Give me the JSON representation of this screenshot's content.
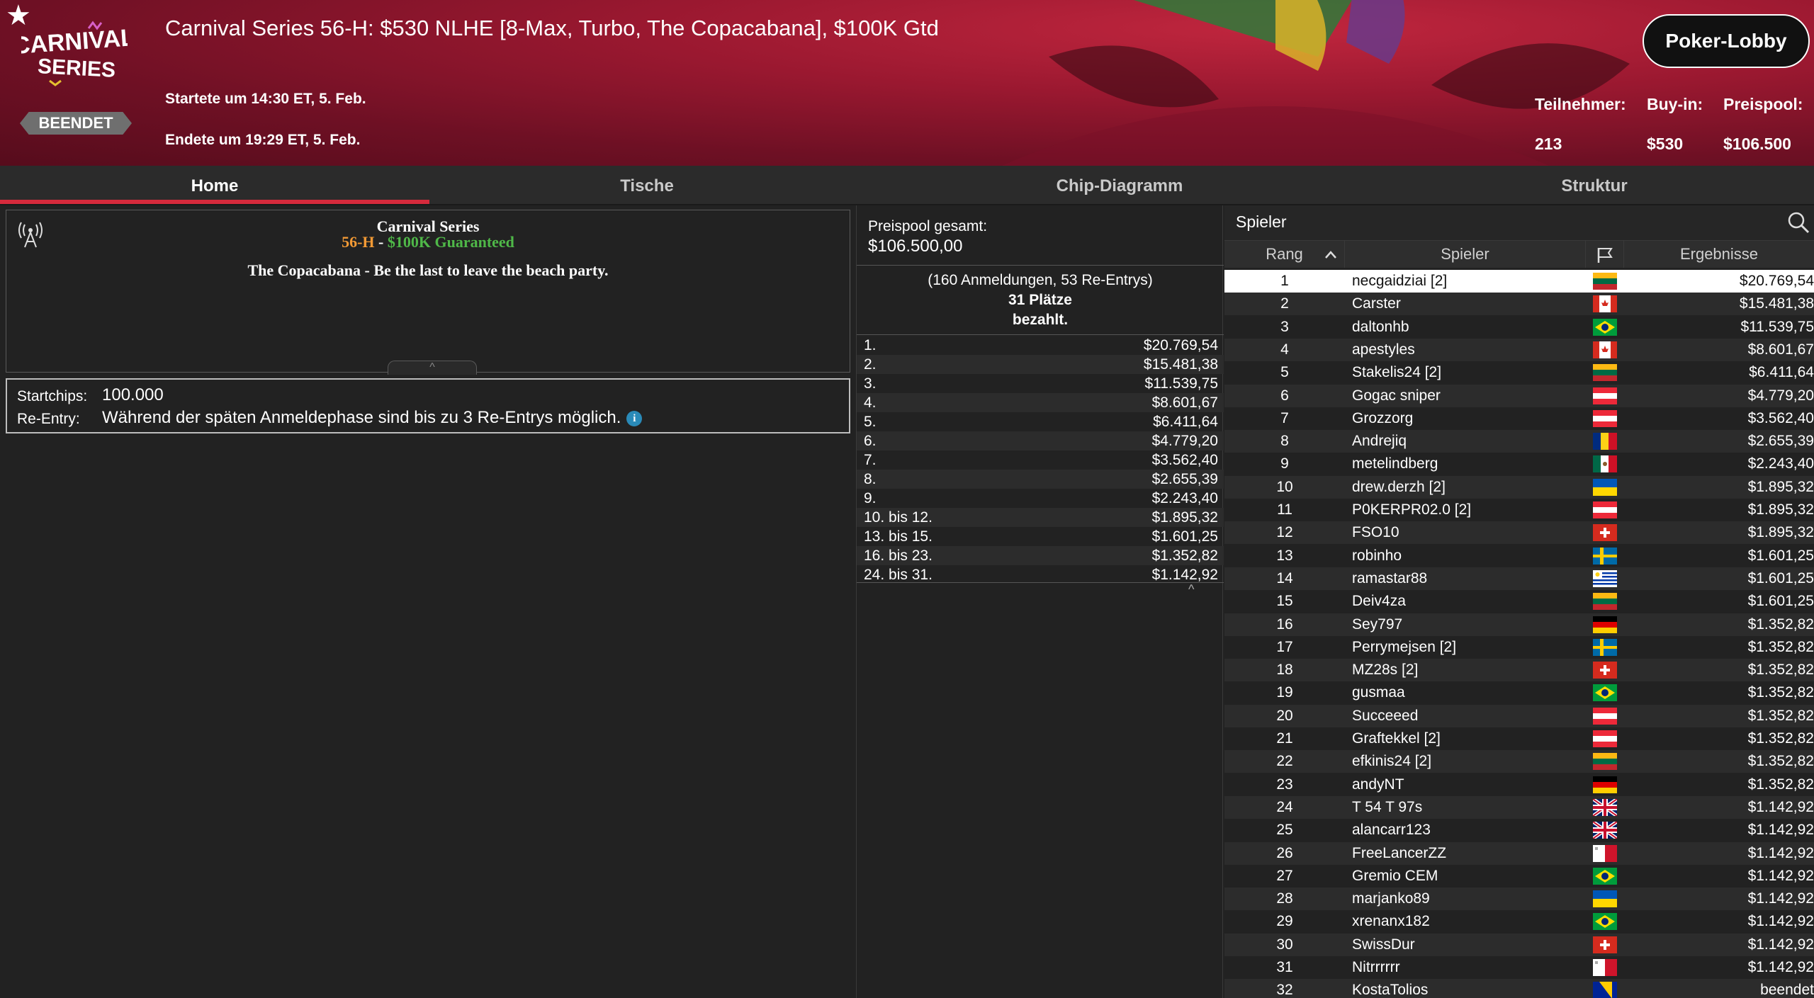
{
  "header": {
    "title": "Carnival Series 56-H: $530 NLHE [8-Max, Turbo, The Copacabana], $100K Gtd",
    "logo_text": "CARNIVAL SERIES",
    "status_badge": "BEENDET",
    "started": "Startete um 14:30 ET, 5. Feb.",
    "ended": "Endete um 19:29 ET, 5. Feb.",
    "lobby_button": "Poker-Lobby",
    "stats": {
      "participants_label": "Teilnehmer:",
      "participants_value": "213",
      "buyin_label": "Buy-in:",
      "buyin_value": "$530",
      "prizepool_label": "Preispool:",
      "prizepool_value": "$106.500"
    }
  },
  "tabs": [
    {
      "label": "Home",
      "active": true
    },
    {
      "label": "Tische",
      "active": false
    },
    {
      "label": "Chip-Diagramm",
      "active": false
    },
    {
      "label": "Struktur",
      "active": false
    }
  ],
  "info": {
    "series_name": "Carnival Series",
    "event_code": "56-H",
    "separator": " - ",
    "guarantee": "$100K Guaranteed",
    "description": "The Copacabana - Be the last to leave the beach party.",
    "collapse_glyph": "^"
  },
  "rules": {
    "startchips_label": "Startchips:",
    "startchips_value": "100.000",
    "reentry_label": "Re-Entry:",
    "reentry_value": "Während der späten Anmeldephase sind bis zu 3 Re-Entrys möglich.",
    "info_glyph": "i"
  },
  "payouts": {
    "pool_label": "Preispool gesamt:",
    "pool_value": "$106.500,00",
    "entries_line1": "(160 Anmeldungen, 53 Re-Entrys)",
    "entries_line2": "31 Plätze",
    "entries_line3": "bezahlt.",
    "rows": [
      {
        "rank": "1.",
        "amount": "$20.769,54"
      },
      {
        "rank": "2.",
        "amount": "$15.481,38"
      },
      {
        "rank": "3.",
        "amount": "$11.539,75"
      },
      {
        "rank": "4.",
        "amount": "$8.601,67"
      },
      {
        "rank": "5.",
        "amount": "$6.411,64"
      },
      {
        "rank": "6.",
        "amount": "$4.779,20"
      },
      {
        "rank": "7.",
        "amount": "$3.562,40"
      },
      {
        "rank": "8.",
        "amount": "$2.655,39"
      },
      {
        "rank": "9.",
        "amount": "$2.243,40"
      },
      {
        "rank": "10. bis 12.",
        "amount": "$1.895,32"
      },
      {
        "rank": "13. bis 15.",
        "amount": "$1.601,25"
      },
      {
        "rank": "16. bis 23.",
        "amount": "$1.352,82"
      },
      {
        "rank": "24. bis 31.",
        "amount": "$1.142,92"
      }
    ],
    "collapse_glyph": "^"
  },
  "players": {
    "search_label": "Spieler",
    "columns": {
      "rank": "Rang",
      "player": "Spieler",
      "results": "Ergebnisse"
    },
    "rows": [
      {
        "rank": "1",
        "name": "necgaidziai [2]",
        "flag": "lithuania",
        "result": "$20.769,54"
      },
      {
        "rank": "2",
        "name": "Carster",
        "flag": "canada",
        "result": "$15.481,38"
      },
      {
        "rank": "3",
        "name": "daltonhb",
        "flag": "brazil",
        "result": "$11.539,75"
      },
      {
        "rank": "4",
        "name": "apestyles",
        "flag": "canada",
        "result": "$8.601,67"
      },
      {
        "rank": "5",
        "name": "Stakelis24 [2]",
        "flag": "lithuania",
        "result": "$6.411,64"
      },
      {
        "rank": "6",
        "name": "Gogac sniper",
        "flag": "austria",
        "result": "$4.779,20"
      },
      {
        "rank": "7",
        "name": "Grozzorg",
        "flag": "austria",
        "result": "$3.562,40"
      },
      {
        "rank": "8",
        "name": "Andrejiq",
        "flag": "romania",
        "result": "$2.655,39"
      },
      {
        "rank": "9",
        "name": "metelindberg",
        "flag": "mexico",
        "result": "$2.243,40"
      },
      {
        "rank": "10",
        "name": "drew.derzh [2]",
        "flag": "ukraine",
        "result": "$1.895,32"
      },
      {
        "rank": "11",
        "name": "P0KERPR02.0 [2]",
        "flag": "austria",
        "result": "$1.895,32"
      },
      {
        "rank": "12",
        "name": "FSO10",
        "flag": "switzerland",
        "result": "$1.895,32"
      },
      {
        "rank": "13",
        "name": "robinho",
        "flag": "sweden",
        "result": "$1.601,25"
      },
      {
        "rank": "14",
        "name": "ramastar88",
        "flag": "uruguay",
        "result": "$1.601,25"
      },
      {
        "rank": "15",
        "name": "Deiv4za",
        "flag": "lithuania",
        "result": "$1.601,25"
      },
      {
        "rank": "16",
        "name": "Sey797",
        "flag": "germany",
        "result": "$1.352,82"
      },
      {
        "rank": "17",
        "name": "Perrymejsen [2]",
        "flag": "sweden",
        "result": "$1.352,82"
      },
      {
        "rank": "18",
        "name": "MZ28s [2]",
        "flag": "switzerland",
        "result": "$1.352,82"
      },
      {
        "rank": "19",
        "name": "gusmaa",
        "flag": "brazil",
        "result": "$1.352,82"
      },
      {
        "rank": "20",
        "name": "Succeeed",
        "flag": "austria",
        "result": "$1.352,82"
      },
      {
        "rank": "21",
        "name": "Graftekkel [2]",
        "flag": "austria",
        "result": "$1.352,82"
      },
      {
        "rank": "22",
        "name": "efkinis24 [2]",
        "flag": "lithuania",
        "result": "$1.352,82"
      },
      {
        "rank": "23",
        "name": "andyNT",
        "flag": "germany",
        "result": "$1.352,82"
      },
      {
        "rank": "24",
        "name": "T 54 T 97s",
        "flag": "uk",
        "result": "$1.142,92"
      },
      {
        "rank": "25",
        "name": "alancarr123",
        "flag": "uk",
        "result": "$1.142,92"
      },
      {
        "rank": "26",
        "name": "FreeLancerZZ",
        "flag": "malta",
        "result": "$1.142,92"
      },
      {
        "rank": "27",
        "name": "Gremio CEM",
        "flag": "brazil",
        "result": "$1.142,92"
      },
      {
        "rank": "28",
        "name": "marjanko89",
        "flag": "ukraine",
        "result": "$1.142,92"
      },
      {
        "rank": "29",
        "name": "xrenanx182",
        "flag": "brazil",
        "result": "$1.142,92"
      },
      {
        "rank": "30",
        "name": "SwissDur",
        "flag": "switzerland",
        "result": "$1.142,92"
      },
      {
        "rank": "31",
        "name": "Nitrrrrrr",
        "flag": "malta",
        "result": "$1.142,92"
      },
      {
        "rank": "32",
        "name": "KostaTolios",
        "flag": "bosnia",
        "result": "beendet"
      }
    ]
  },
  "colors": {
    "accent": "#d62a3c",
    "guarantee_green": "#4fb848",
    "event_orange": "#f39a35",
    "info_blue": "#2a8ab8"
  }
}
